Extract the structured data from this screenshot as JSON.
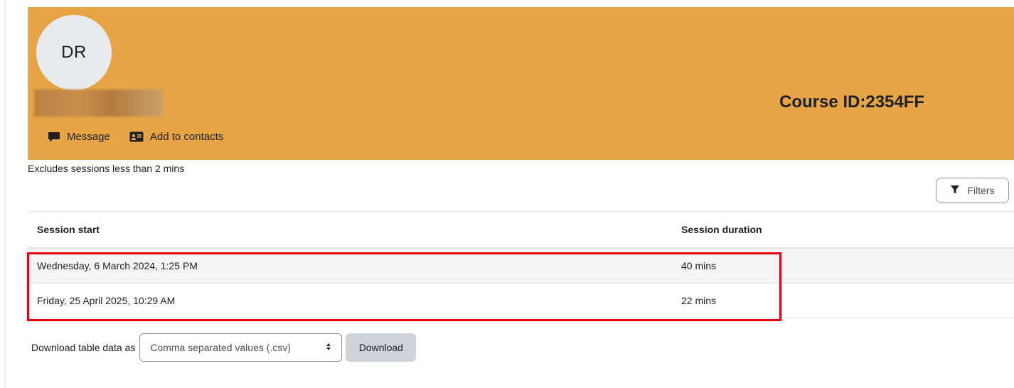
{
  "profile": {
    "initials": "DR",
    "course_id": "Course ID:2354FF",
    "actions": {
      "message": "Message",
      "add_contacts": "Add to contacts"
    }
  },
  "note": "Excludes sessions less than 2 mins",
  "filters_label": "Filters",
  "table": {
    "headers": [
      "Session start",
      "Session duration"
    ],
    "rows": [
      [
        "Wednesday, 6 March 2024, 1:25 PM",
        "40 mins"
      ],
      [
        "Friday, 25 April 2025, 10:29 AM",
        "22 mins"
      ]
    ]
  },
  "download": {
    "label": "Download table data as",
    "format_selected": "Comma separated values (.csv)",
    "button": "Download"
  },
  "colors": {
    "header_bg": "#e6a444",
    "highlight": "#e4000f"
  }
}
